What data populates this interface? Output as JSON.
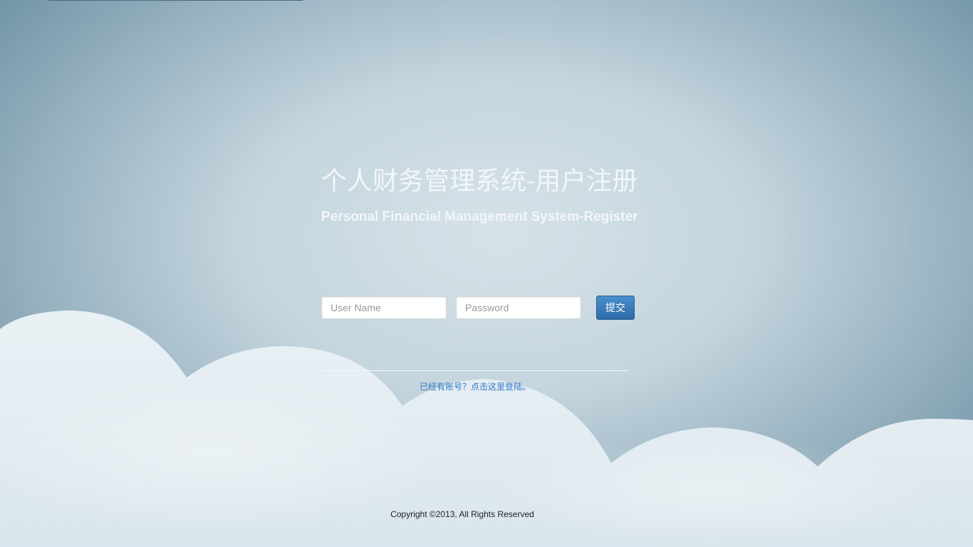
{
  "header": {
    "title": "个人财务管理系统-用户注册",
    "subtitle": "Personal Financial Management System-Register"
  },
  "form": {
    "username_placeholder": "User Name",
    "password_placeholder": "Password",
    "username_value": "",
    "password_value": "",
    "submit_label": "提交"
  },
  "footer": {
    "login_link": "已经有账号？点击这里登陆。",
    "copyright": "Copyright ©2013, All Rights Reserved"
  },
  "colors": {
    "accent": "#2d6aa8",
    "link": "#2f77c6",
    "background": "#c4d5de",
    "cloud": "#e8f0f4"
  }
}
